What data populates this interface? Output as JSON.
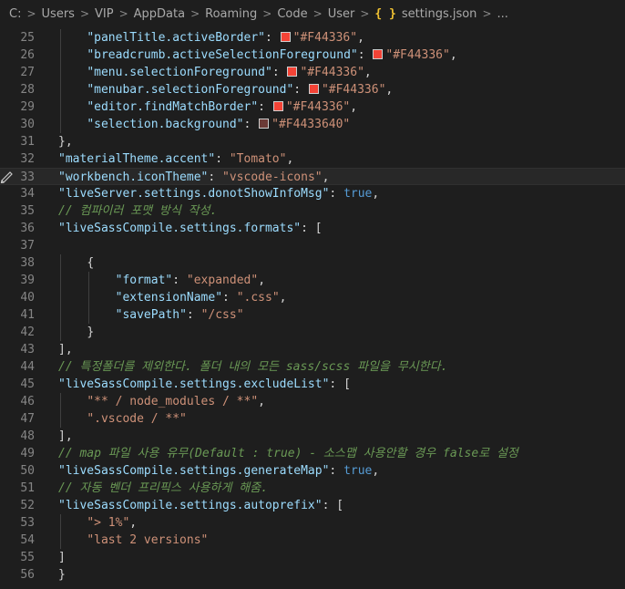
{
  "breadcrumb": {
    "segments": [
      "C:",
      "Users",
      "VIP",
      "AppData",
      "Roaming",
      "Code",
      "User"
    ],
    "file_icon": "{ }",
    "file": "settings.json",
    "ellipsis": "...",
    "separator": ">"
  },
  "colors": {
    "accent": "#F44336",
    "selection": "#F4433640"
  },
  "lines": [
    {
      "n": "25",
      "indent": 2,
      "tokens": [
        {
          "t": "k",
          "v": "\"panelTitle.activeBorder\""
        },
        {
          "t": "p",
          "v": ": "
        },
        {
          "t": "sw",
          "v": "#F44336"
        },
        {
          "t": "s",
          "v": "\"#F44336\""
        },
        {
          "t": "p",
          "v": ","
        }
      ]
    },
    {
      "n": "26",
      "indent": 2,
      "tokens": [
        {
          "t": "k",
          "v": "\"breadcrumb.activeSelectionForeground\""
        },
        {
          "t": "p",
          "v": ": "
        },
        {
          "t": "sw",
          "v": "#F44336"
        },
        {
          "t": "s",
          "v": "\"#F44336\""
        },
        {
          "t": "p",
          "v": ","
        }
      ]
    },
    {
      "n": "27",
      "indent": 2,
      "tokens": [
        {
          "t": "k",
          "v": "\"menu.selectionForeground\""
        },
        {
          "t": "p",
          "v": ": "
        },
        {
          "t": "sw",
          "v": "#F44336"
        },
        {
          "t": "s",
          "v": "\"#F44336\""
        },
        {
          "t": "p",
          "v": ","
        }
      ]
    },
    {
      "n": "28",
      "indent": 2,
      "tokens": [
        {
          "t": "k",
          "v": "\"menubar.selectionForeground\""
        },
        {
          "t": "p",
          "v": ": "
        },
        {
          "t": "sw",
          "v": "#F44336"
        },
        {
          "t": "s",
          "v": "\"#F44336\""
        },
        {
          "t": "p",
          "v": ","
        }
      ]
    },
    {
      "n": "29",
      "indent": 2,
      "tokens": [
        {
          "t": "k",
          "v": "\"editor.findMatchBorder\""
        },
        {
          "t": "p",
          "v": ": "
        },
        {
          "t": "sw",
          "v": "#F44336"
        },
        {
          "t": "s",
          "v": "\"#F44336\""
        },
        {
          "t": "p",
          "v": ","
        }
      ]
    },
    {
      "n": "30",
      "indent": 2,
      "tokens": [
        {
          "t": "k",
          "v": "\"selection.background\""
        },
        {
          "t": "p",
          "v": ": "
        },
        {
          "t": "sw",
          "v": "#6b3a36"
        },
        {
          "t": "s",
          "v": "\"#F4433640\""
        }
      ]
    },
    {
      "n": "31",
      "indent": 1,
      "tokens": [
        {
          "t": "p",
          "v": "},"
        }
      ]
    },
    {
      "n": "32",
      "indent": 1,
      "tokens": [
        {
          "t": "k",
          "v": "\"materialTheme.accent\""
        },
        {
          "t": "p",
          "v": ": "
        },
        {
          "t": "s",
          "v": "\"Tomato\""
        },
        {
          "t": "p",
          "v": ","
        }
      ]
    },
    {
      "n": "33",
      "indent": 1,
      "current": true,
      "tokens": [
        {
          "t": "k",
          "v": "\"workbench.iconTheme\""
        },
        {
          "t": "p",
          "v": ": "
        },
        {
          "t": "s",
          "v": "\"vscode-icons\""
        },
        {
          "t": "p",
          "v": ","
        }
      ]
    },
    {
      "n": "34",
      "indent": 1,
      "tokens": [
        {
          "t": "k",
          "v": "\"liveServer.settings.donotShowInfoMsg\""
        },
        {
          "t": "p",
          "v": ": "
        },
        {
          "t": "b",
          "v": "true"
        },
        {
          "t": "p",
          "v": ","
        }
      ]
    },
    {
      "n": "35",
      "indent": 1,
      "tokens": [
        {
          "t": "c",
          "v": "// 컴파이러 포맷 방식 작성."
        }
      ]
    },
    {
      "n": "36",
      "indent": 1,
      "tokens": [
        {
          "t": "k",
          "v": "\"liveSassCompile.settings.formats\""
        },
        {
          "t": "p",
          "v": ": ["
        }
      ]
    },
    {
      "n": "37",
      "indent": 0,
      "tokens": []
    },
    {
      "n": "38",
      "indent": 2,
      "tokens": [
        {
          "t": "p",
          "v": "{"
        }
      ]
    },
    {
      "n": "39",
      "indent": 3,
      "tokens": [
        {
          "t": "k",
          "v": "\"format\""
        },
        {
          "t": "p",
          "v": ": "
        },
        {
          "t": "s",
          "v": "\"expanded\""
        },
        {
          "t": "p",
          "v": ","
        }
      ]
    },
    {
      "n": "40",
      "indent": 3,
      "tokens": [
        {
          "t": "k",
          "v": "\"extensionName\""
        },
        {
          "t": "p",
          "v": ": "
        },
        {
          "t": "s",
          "v": "\".css\""
        },
        {
          "t": "p",
          "v": ","
        }
      ]
    },
    {
      "n": "41",
      "indent": 3,
      "tokens": [
        {
          "t": "k",
          "v": "\"savePath\""
        },
        {
          "t": "p",
          "v": ": "
        },
        {
          "t": "s",
          "v": "\"/css\""
        }
      ]
    },
    {
      "n": "42",
      "indent": 2,
      "tokens": [
        {
          "t": "p",
          "v": "}"
        }
      ]
    },
    {
      "n": "43",
      "indent": 1,
      "tokens": [
        {
          "t": "p",
          "v": "],"
        }
      ]
    },
    {
      "n": "44",
      "indent": 1,
      "tokens": [
        {
          "t": "c",
          "v": "// 특정폴더를 제외한다. 폴더 내의 모든 sass/scss 파일을 무시한다."
        }
      ]
    },
    {
      "n": "45",
      "indent": 1,
      "tokens": [
        {
          "t": "k",
          "v": "\"liveSassCompile.settings.excludeList\""
        },
        {
          "t": "p",
          "v": ": ["
        }
      ]
    },
    {
      "n": "46",
      "indent": 2,
      "tokens": [
        {
          "t": "s",
          "v": "\"** / node_modules / **\""
        },
        {
          "t": "p",
          "v": ","
        }
      ]
    },
    {
      "n": "47",
      "indent": 2,
      "tokens": [
        {
          "t": "s",
          "v": "\".vscode / **\""
        }
      ]
    },
    {
      "n": "48",
      "indent": 1,
      "tokens": [
        {
          "t": "p",
          "v": "],"
        }
      ]
    },
    {
      "n": "49",
      "indent": 1,
      "tokens": [
        {
          "t": "c",
          "v": "// map 파일 사용 유무(Default : true) - 소스맵 사용안할 경우 false로 설정"
        }
      ]
    },
    {
      "n": "50",
      "indent": 1,
      "tokens": [
        {
          "t": "k",
          "v": "\"liveSassCompile.settings.generateMap\""
        },
        {
          "t": "p",
          "v": ": "
        },
        {
          "t": "b",
          "v": "true"
        },
        {
          "t": "p",
          "v": ","
        }
      ]
    },
    {
      "n": "51",
      "indent": 1,
      "tokens": [
        {
          "t": "c",
          "v": "// 자동 벤더 프리픽스 사용하게 해줌."
        }
      ]
    },
    {
      "n": "52",
      "indent": 1,
      "tokens": [
        {
          "t": "k",
          "v": "\"liveSassCompile.settings.autoprefix\""
        },
        {
          "t": "p",
          "v": ": ["
        }
      ]
    },
    {
      "n": "53",
      "indent": 2,
      "tokens": [
        {
          "t": "s",
          "v": "\"> 1%\""
        },
        {
          "t": "p",
          "v": ","
        }
      ]
    },
    {
      "n": "54",
      "indent": 2,
      "tokens": [
        {
          "t": "s",
          "v": "\"last 2 versions\""
        }
      ]
    },
    {
      "n": "55",
      "indent": 1,
      "tokens": [
        {
          "t": "p",
          "v": "]"
        }
      ]
    },
    {
      "n": "56",
      "indent": 0,
      "tokens": [
        {
          "t": "p",
          "v": "}"
        }
      ]
    }
  ]
}
